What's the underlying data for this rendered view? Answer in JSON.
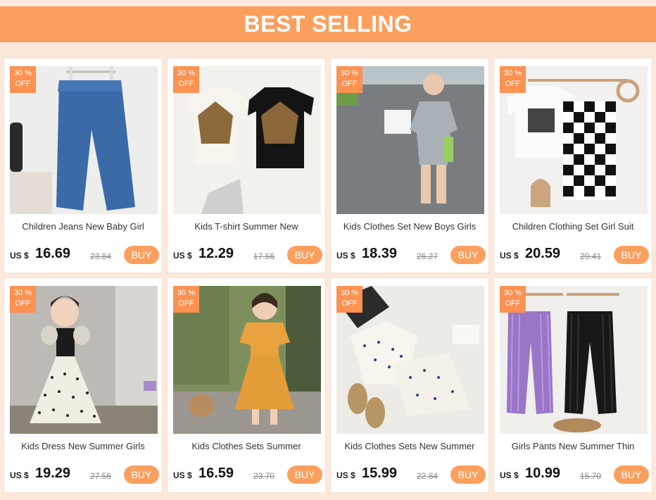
{
  "header": {
    "title": "BEST SELLING"
  },
  "products": [
    {
      "badge_line1": "30 %",
      "badge_line2": "OFF",
      "title": "Children Jeans New Baby Girl",
      "currency": "US $",
      "price": "16.69",
      "old_price": "23.84",
      "buy_label": "BUY",
      "image": "jeans-photo"
    },
    {
      "badge_line1": "30 %",
      "badge_line2": "OFF",
      "title": "Kids T-shirt Summer New",
      "currency": "US $",
      "price": "12.29",
      "old_price": "17.56",
      "buy_label": "BUY",
      "image": "tshirts-photo"
    },
    {
      "badge_line1": "30 %",
      "badge_line2": "OFF",
      "title": "Kids Clothes Set New Boys Girls",
      "currency": "US $",
      "price": "18.39",
      "old_price": "26.27",
      "buy_label": "BUY",
      "image": "child-outfit-photo"
    },
    {
      "badge_line1": "30 %",
      "badge_line2": "OFF",
      "title": "Children Clothing Set Girl Suit",
      "currency": "US $",
      "price": "20.59",
      "old_price": "29.41",
      "buy_label": "BUY",
      "image": "checker-set-photo"
    },
    {
      "badge_line1": "30 %",
      "badge_line2": "OFF",
      "title": "Kids Dress New Summer Girls",
      "currency": "US $",
      "price": "19.29",
      "old_price": "27.56",
      "buy_label": "BUY",
      "image": "polka-dress-photo"
    },
    {
      "badge_line1": "30 %",
      "badge_line2": "OFF",
      "title": "Kids Clothes Sets Summer",
      "currency": "US $",
      "price": "16.59",
      "old_price": "23.70",
      "buy_label": "BUY",
      "image": "yellow-set-photo"
    },
    {
      "badge_line1": "30 %",
      "badge_line2": "OFF",
      "title": "Kids Clothes Sets New Summer",
      "currency": "US $",
      "price": "15.99",
      "old_price": "22.84",
      "buy_label": "BUY",
      "image": "dotted-set-photo"
    },
    {
      "badge_line1": "30 %",
      "badge_line2": "OFF",
      "title": "Girls Pants New Summer Thin",
      "currency": "US $",
      "price": "10.99",
      "old_price": "15.70",
      "buy_label": "BUY",
      "image": "pants-photo"
    }
  ],
  "colors": {
    "accent": "#fb9f5f",
    "badge": "#fb9252",
    "background": "#fde9dc"
  }
}
